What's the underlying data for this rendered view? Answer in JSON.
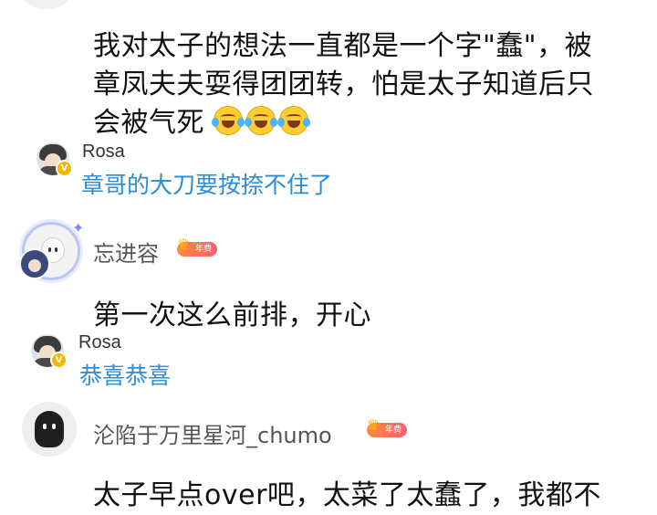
{
  "comments": [
    {
      "text_line1": "我对太子的想法一直都是一个字\"蠢\"，被",
      "text_line2": "章凤夫夫耍得团团转，怕是太子知道后只",
      "text_line3": "会被气死",
      "emoji": "laughing-crying-emoji",
      "reply": {
        "name": "Rosa",
        "text": "章哥的大刀要按捺不住了"
      }
    },
    {
      "name": "忘进容",
      "badge": "年费",
      "text": "第一次这么前排，开心",
      "reply": {
        "name": "Rosa",
        "text": "恭喜恭喜"
      }
    },
    {
      "name": "沦陷于万里星河_chumo",
      "badge": "年费",
      "text": "太子早点over吧，太菜了太蠢了，我都不"
    }
  ],
  "colors": {
    "reply_text": "#2a8bd6",
    "body_text": "#111111",
    "name_text": "#555555",
    "badge": "#ff7043",
    "v_badge": "#f5b700"
  }
}
